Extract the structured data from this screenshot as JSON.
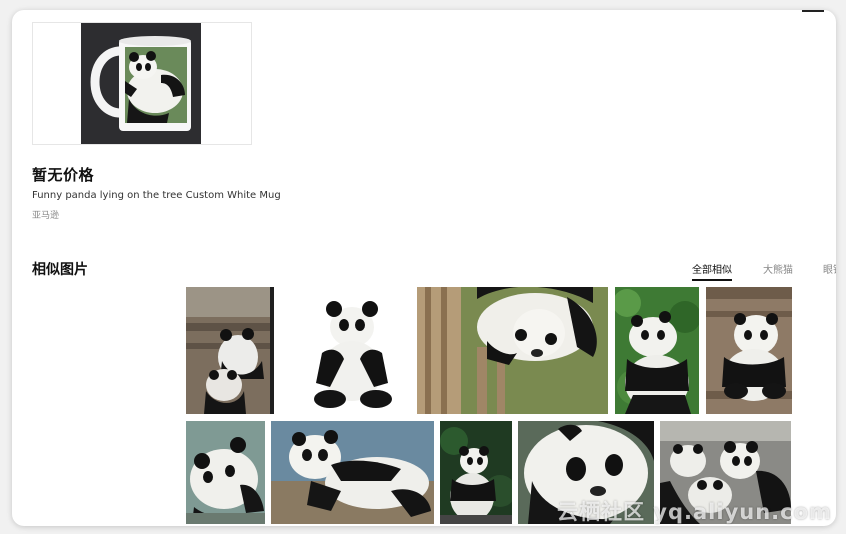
{
  "product": {
    "price": "暂无价格",
    "title": "Funny panda lying on the tree Custom White Mug",
    "source": "亚马逊"
  },
  "similar": {
    "title": "相似图片",
    "tabs": [
      {
        "label": "全部相似",
        "active": true
      },
      {
        "label": "大熊猫",
        "active": false
      },
      {
        "label": "眼镜",
        "active": false
      }
    ]
  },
  "watermark": "云栖社区 yq.aliyun.com",
  "colors": {
    "accent": "#111111",
    "muted": "#888888",
    "card_border": "#e6e6e6"
  }
}
